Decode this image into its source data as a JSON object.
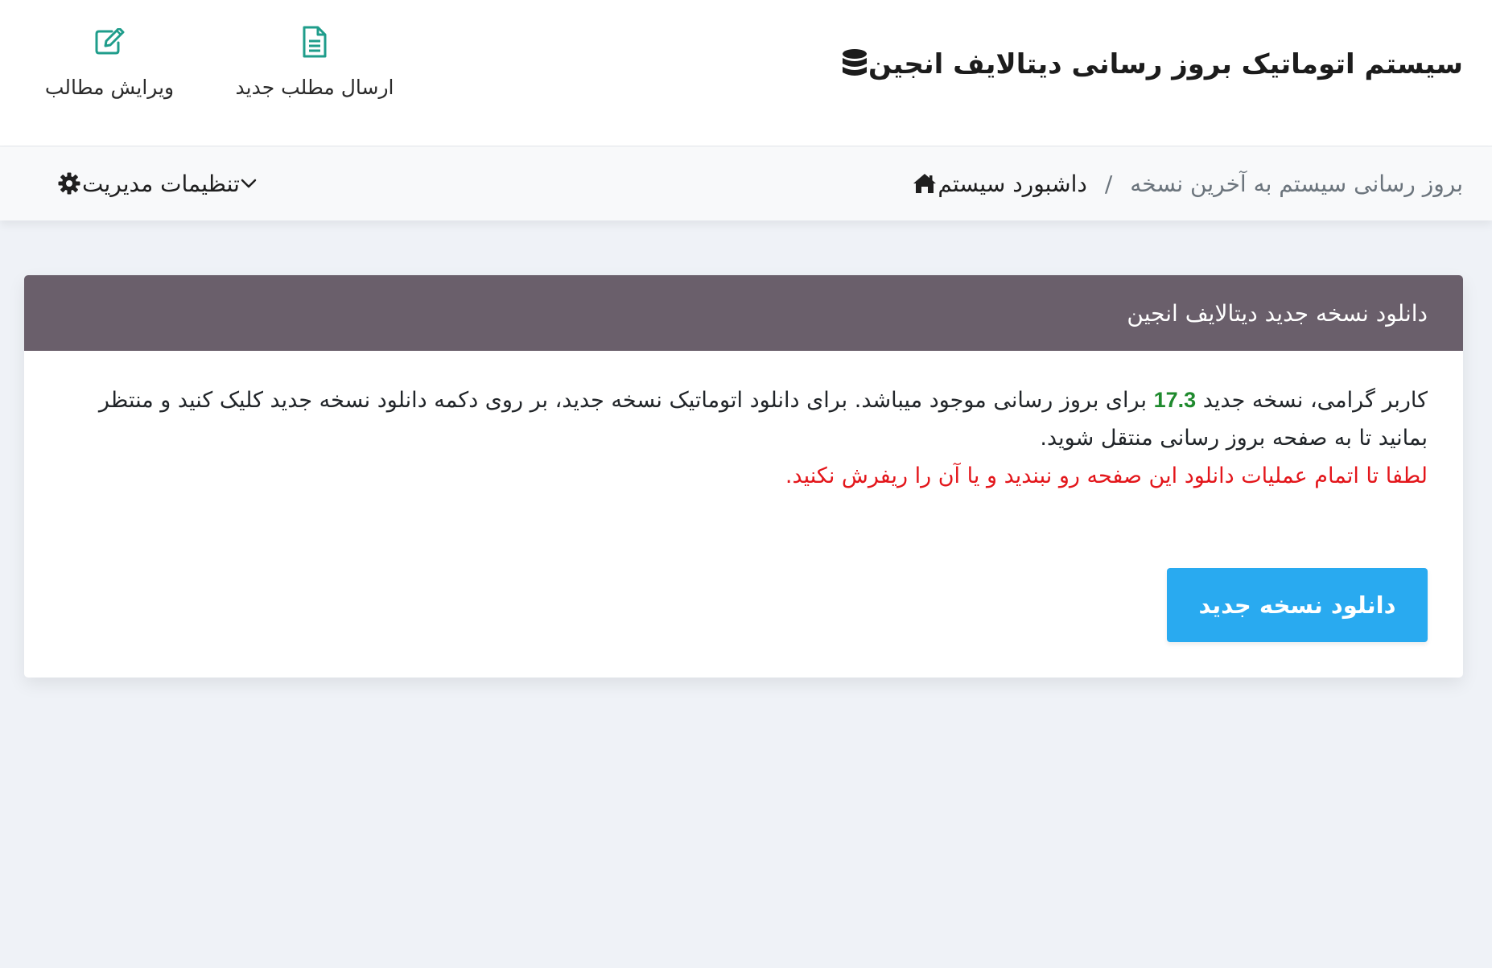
{
  "header": {
    "brand_title": "سیستم اتوماتیک بروز رسانی دیتالایف انجین",
    "brand_icon": "database-icon",
    "quick_actions": [
      {
        "label": "ارسال مطلب جدید",
        "icon": "file-text-icon"
      },
      {
        "label": "ویرایش مطالب",
        "icon": "edit-icon"
      }
    ],
    "accent_color": "#1f9d8b"
  },
  "breadcrumb": {
    "home_icon": "home-icon",
    "home_label": "داشبورد سیستم",
    "separator": "/",
    "current": "بروز رسانی سیستم به آخرین نسخه"
  },
  "admin_menu": {
    "label": "تنظیمات مدیریت",
    "icon": "gear-icon"
  },
  "card": {
    "title": "دانلود نسخه جدید دیتالایف انجین",
    "header_color": "#6a5f6b",
    "message_before_version": "کاربر گرامی، نسخه جدید",
    "version": "17.3",
    "message_after_version": "برای بروز رسانی موجود میباشد. برای دانلود اتوماتیک نسخه جدید، بر روی دکمه دانلود نسخه جدید کلیک کنید و منتظر بمانید تا به صفحه بروز رسانی منتقل شوید.",
    "warning": "لطفا تا اتمام عملیات دانلود این صفحه رو نبندید و یا آن را ریفرش نکنید.",
    "warning_color": "#e3161b",
    "version_color": "#1f8a2e",
    "download_button": "دانلود نسخه جدید",
    "button_color": "#29aaf0"
  }
}
